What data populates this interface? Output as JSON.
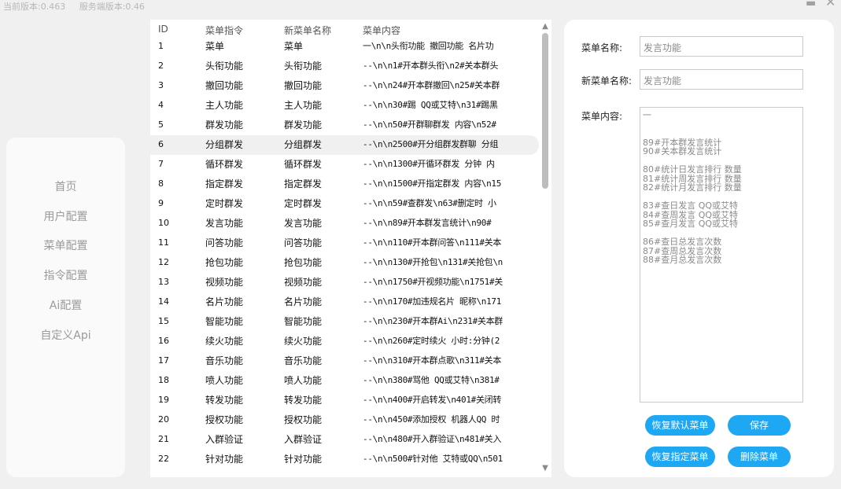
{
  "titlebar": {
    "client_version": "当前版本:0.463",
    "server_version": "服务端版本:0.46",
    "min_glyph": "▬",
    "close_glyph": "✕"
  },
  "sidebar": {
    "items": [
      {
        "label": "首页"
      },
      {
        "label": "用户配置"
      },
      {
        "label": "菜单配置"
      },
      {
        "label": "指令配置"
      },
      {
        "label": "Ai配置"
      },
      {
        "label": "自定义Api"
      }
    ]
  },
  "table": {
    "headers": {
      "id": "ID",
      "command": "菜单指令",
      "new_name": "新菜单名称",
      "content": "菜单内容"
    },
    "selected_index": 5,
    "rows": [
      {
        "id": "1",
        "command": "菜单",
        "new_name": "菜单",
        "content": "一\\n\\n头衔功能 撤回功能 名片功"
      },
      {
        "id": "2",
        "command": "头衔功能",
        "new_name": "头衔功能",
        "content": "--\\n\\n1#开本群头衔\\n2#关本群头"
      },
      {
        "id": "3",
        "command": "撤回功能",
        "new_name": "撤回功能",
        "content": "--\\n\\n24#开本群撤回\\n25#关本群"
      },
      {
        "id": "4",
        "command": "主人功能",
        "new_name": "主人功能",
        "content": "--\\n\\n30#踢 QQ或艾特\\n31#踢黑"
      },
      {
        "id": "5",
        "command": "群发功能",
        "new_name": "群发功能",
        "content": "--\\n\\n50#开群聊群发 内容\\n52#"
      },
      {
        "id": "6",
        "command": "分组群发",
        "new_name": "分组群发",
        "content": "--\\n\\n2500#开分组群发群聊 分组"
      },
      {
        "id": "7",
        "command": "循环群发",
        "new_name": "循环群发",
        "content": "--\\n\\n1300#开循环群发 分钟 内"
      },
      {
        "id": "8",
        "command": "指定群发",
        "new_name": "指定群发",
        "content": "--\\n\\n1500#开指定群发 内容\\n15"
      },
      {
        "id": "9",
        "command": "定时群发",
        "new_name": "定时群发",
        "content": "--\\n\\n59#查群发\\n63#删定时 小"
      },
      {
        "id": "10",
        "command": "发言功能",
        "new_name": "发言功能",
        "content": "--\\n\\n89#开本群发言统计\\n90#"
      },
      {
        "id": "11",
        "command": "问答功能",
        "new_name": "问答功能",
        "content": "--\\n\\n110#开本群问答\\n111#关本"
      },
      {
        "id": "12",
        "command": "抢包功能",
        "new_name": "抢包功能",
        "content": "--\\n\\n130#开抢包\\n131#关抢包\\n"
      },
      {
        "id": "13",
        "command": "视频功能",
        "new_name": "视频功能",
        "content": "--\\n\\n1750#开视频功能\\n1751#关"
      },
      {
        "id": "14",
        "command": "名片功能",
        "new_name": "名片功能",
        "content": "--\\n\\n170#加违规名片 昵称\\n171"
      },
      {
        "id": "15",
        "command": "智能功能",
        "new_name": "智能功能",
        "content": "--\\n\\n230#开本群Ai\\n231#关本群"
      },
      {
        "id": "16",
        "command": "续火功能",
        "new_name": "续火功能",
        "content": "--\\n\\n260#定时续火 小时:分钟(2"
      },
      {
        "id": "17",
        "command": "音乐功能",
        "new_name": "音乐功能",
        "content": "--\\n\\n310#开本群点歌\\n311#关本"
      },
      {
        "id": "18",
        "command": "喷人功能",
        "new_name": "喷人功能",
        "content": "--\\n\\n380#骂他 QQ或艾特\\n381#"
      },
      {
        "id": "19",
        "command": "转发功能",
        "new_name": "转发功能",
        "content": "--\\n\\n400#开启转发\\n401#关闭转"
      },
      {
        "id": "20",
        "command": "授权功能",
        "new_name": "授权功能",
        "content": "--\\n\\n450#添加授权 机器人QQ 时"
      },
      {
        "id": "21",
        "command": "入群验证",
        "new_name": "入群验证",
        "content": "--\\n\\n480#开入群验证\\n481#关入"
      },
      {
        "id": "22",
        "command": "针对功能",
        "new_name": "针对功能",
        "content": "--\\n\\n500#针对他 艾特或QQ\\n501"
      }
    ],
    "scroll_up_glyph": "▲",
    "scroll_down_glyph": "▼"
  },
  "editor": {
    "menu_name_label": "菜单名称:",
    "menu_name_value": "发言功能",
    "new_menu_name_label": "新菜单名称:",
    "new_menu_name_value": "发言功能",
    "menu_content_label": "菜单内容:",
    "menu_content_value": "一\n\n\n89#开本群发言统计\n90#关本群发言统计\n\n80#统计日发言排行 数量\n81#统计周发言排行 数量\n82#统计月发言排行 数量\n\n83#查日发言 QQ或艾特\n84#查周发言 QQ或艾特\n85#查月发言 QQ或艾特\n\n86#查日总发言次数\n87#查周总发言次数\n88#查月总发言次数",
    "buttons": {
      "restore_default": "恢复默认菜单",
      "save": "保存",
      "restore_specified": "恢复指定菜单",
      "delete": "删除菜单"
    },
    "accent_color": "#1ea7f2"
  }
}
